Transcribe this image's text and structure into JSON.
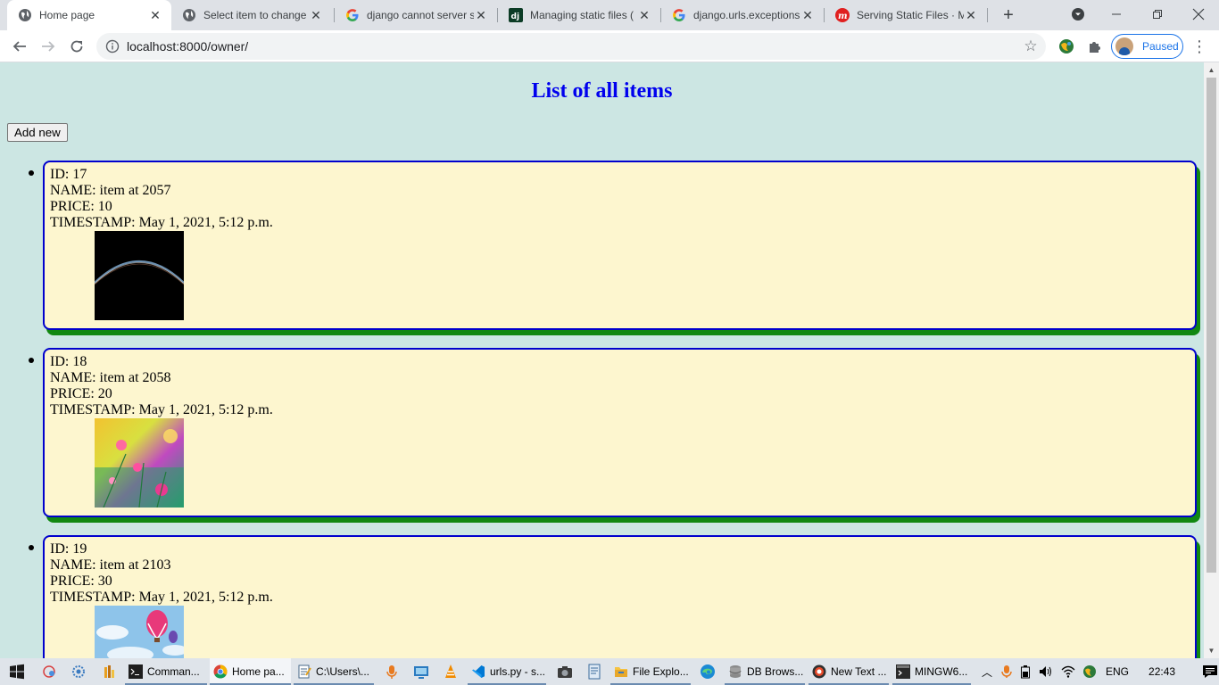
{
  "browser": {
    "tabs": [
      {
        "title": "Home page",
        "active": true
      },
      {
        "title": "Select item to change"
      },
      {
        "title": "django cannot server s"
      },
      {
        "title": "Managing static files ("
      },
      {
        "title": "django.urls.exceptions"
      },
      {
        "title": "Serving Static Files · M"
      }
    ],
    "url": "localhost:8000/owner/",
    "profile_label": "Paused",
    "accent": "#1a73e8"
  },
  "page": {
    "title": "List of all items",
    "add_button": "Add new",
    "background": "#cce6e3",
    "card_background": "#fdf6cf",
    "card_border": "#0000cd",
    "card_shadow": "#118811",
    "items": [
      {
        "id": "ID: 17",
        "name": "NAME: item at 2057",
        "price": "PRICE: 10",
        "timestamp": "TIMESTAMP: May 1, 2021, 5:12 p.m.",
        "image": "dark-planet-horizon"
      },
      {
        "id": "ID: 18",
        "name": "NAME: item at 2058",
        "price": "PRICE: 20",
        "timestamp": "TIMESTAMP: May 1, 2021, 5:12 p.m.",
        "image": "colorful-flowers"
      },
      {
        "id": "ID: 19",
        "name": "NAME: item at 2103",
        "price": "PRICE: 30",
        "timestamp": "TIMESTAMP: May 1, 2021, 5:12 p.m.",
        "image": "hot-air-balloons"
      }
    ]
  },
  "taskbar": {
    "apps": [
      {
        "label": "Comman..."
      },
      {
        "label": "Home pa..."
      },
      {
        "label": "C:\\Users\\..."
      },
      {
        "label": "urls.py - s..."
      },
      {
        "label": "File Explo..."
      },
      {
        "label": "DB Brows..."
      },
      {
        "label": "New Text ..."
      },
      {
        "label": "MINGW6..."
      }
    ],
    "language": "ENG",
    "time": "22:43"
  }
}
